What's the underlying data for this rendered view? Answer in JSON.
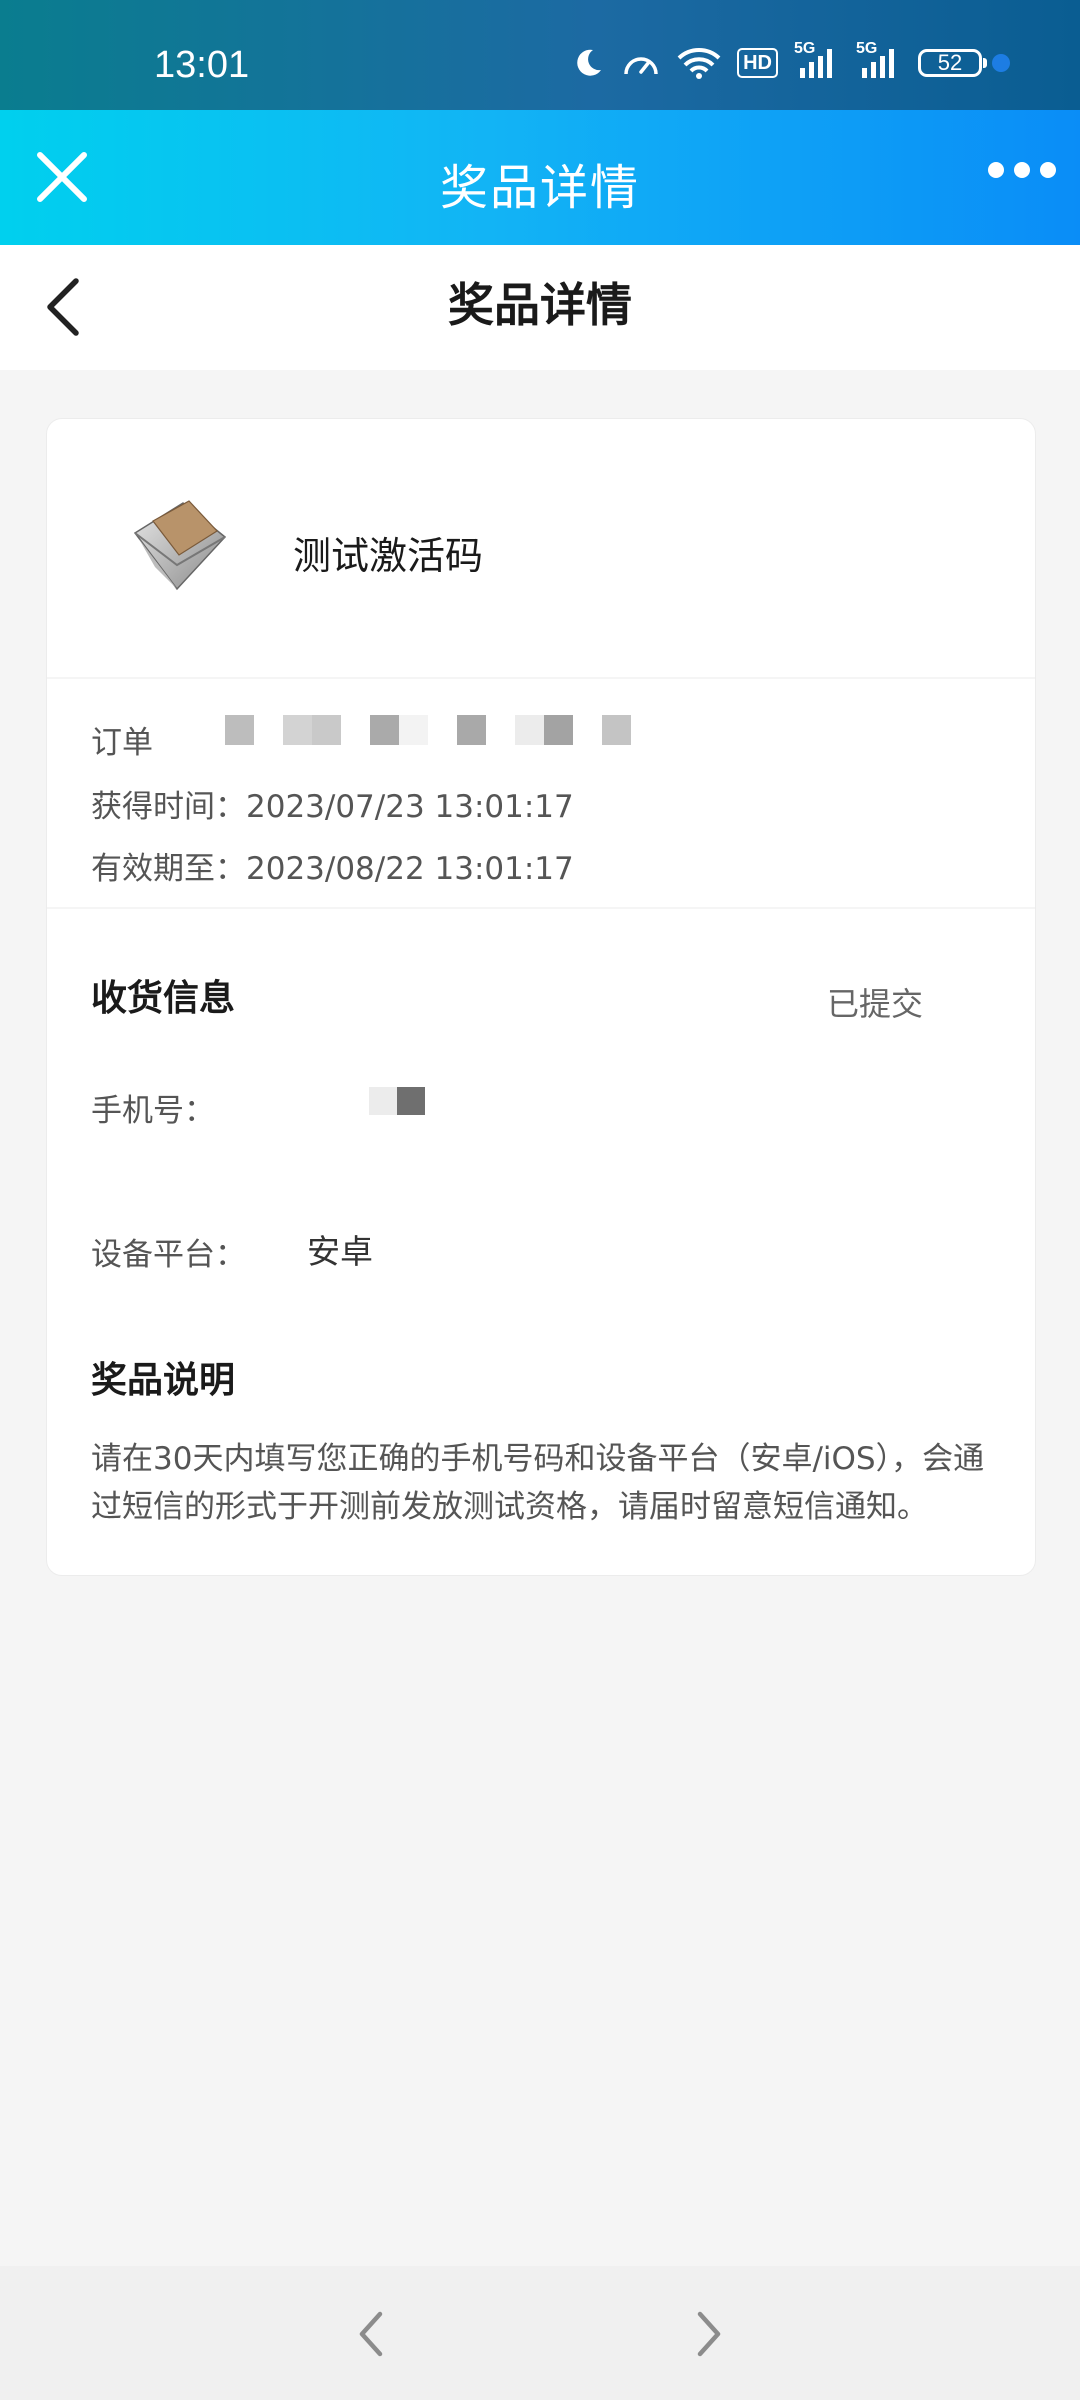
{
  "status_bar": {
    "time": "13:01",
    "battery": "52",
    "icons": [
      "moon-icon",
      "speed-icon",
      "wifi-icon",
      "hd-icon",
      "signal-5g-icon",
      "signal-5g-icon"
    ],
    "hd_label": "HD",
    "net_label_1": "5G",
    "net_label_2": "5G"
  },
  "app_bar": {
    "title": "奖品详情",
    "close_icon": "close-icon",
    "more_icon": "more-icon"
  },
  "page_header": {
    "title": "奖品详情",
    "back_icon": "back-icon"
  },
  "prize": {
    "name": "测试激活码",
    "icon": "envelope-icon"
  },
  "info": {
    "order_label": "订单",
    "obtain_label": "获得时间：",
    "obtain_value": "2023/07/23 13:01:17",
    "expire_label": "有效期至：",
    "expire_value": "2023/08/22 13:01:17"
  },
  "shipping": {
    "title": "收货信息",
    "status": "已提交",
    "phone_label": "手机号：",
    "platform_label": "设备平台：",
    "platform_value": "安卓"
  },
  "description": {
    "title": "奖品说明",
    "text": "请在30天内填写您正确的手机号码和设备平台（安卓/iOS），会通过短信的形式于开测前发放测试资格，请届时留意短信通知。"
  },
  "bottom_nav": {
    "prev_icon": "chevron-left-icon",
    "next_icon": "chevron-right-icon"
  },
  "colors": {
    "app_bar_start": "#00d0ee",
    "app_bar_end": "#0a8df7",
    "status_bar": "#0a6f95",
    "background": "#f5f5f5"
  }
}
